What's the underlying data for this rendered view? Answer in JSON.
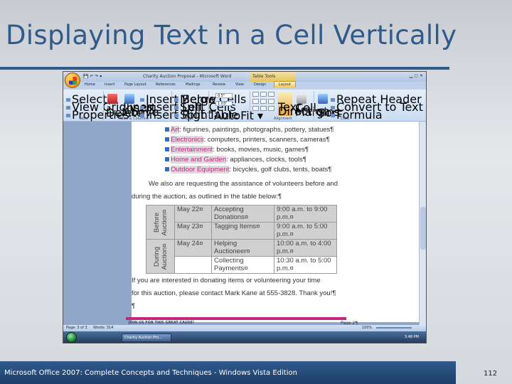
{
  "slide": {
    "title": "Displaying Text in a Cell Vertically",
    "caption": "Microsoft Office 2007: Complete Concepts and Techniques - Windows Vista Edition",
    "page_number": "112"
  },
  "window": {
    "title": "Charity Auction Proposal - Microsoft Word",
    "table_tools_label": "Table Tools",
    "tabs": [
      "Home",
      "Insert",
      "Page Layout",
      "References",
      "Mailings",
      "Review",
      "View",
      "Design",
      "Layout"
    ],
    "active_tab": "Layout"
  },
  "ribbon": {
    "table_group": {
      "select": "Select ▾",
      "view_gridlines": "View Gridlines",
      "properties": "Properties",
      "label": "Table"
    },
    "rows_columns_group": {
      "delete": "Delete",
      "insert_above": "Insert Above",
      "insert_below": "Insert Below",
      "insert_left": "Insert Left",
      "insert_right": "Insert Right",
      "label": "Rows & Columns"
    },
    "merge_group": {
      "merge_cells": "Merge Cells",
      "split_cells": "Split Cells",
      "split_table": "Split Table",
      "label": "Merge"
    },
    "cell_size_group": {
      "height": "0.5\"",
      "width": "1.03\"",
      "autofit": "AutoFit ▾",
      "label": "Cell Size"
    },
    "alignment_group": {
      "text_direction": "Text Direction",
      "cell_margins": "Cell Margins",
      "label": "Alignment"
    },
    "data_group": {
      "sort": "Sort",
      "repeat_header_rows": "Repeat Header Rows",
      "convert_to_text": "Convert to Text",
      "formula": "Formula",
      "label": "Data"
    }
  },
  "document": {
    "bullets": [
      {
        "term": "Art",
        "rest": ": figurines, paintings, photographs, pottery, statues¶"
      },
      {
        "term": "Electronics",
        "rest": ": computers, printers, scanners, cameras¶"
      },
      {
        "term": "Entertainment",
        "rest": ": books, movies, music, games¶"
      },
      {
        "term": "Home and Garden",
        "rest": ": appliances, clocks, tools¶"
      },
      {
        "term": "Outdoor Equipment",
        "rest": ": bicycles, golf clubs, tents, boats¶"
      }
    ],
    "para1_line1": "We also are requesting the assistance of volunteers before and",
    "para1_line2": "during the auction, as outlined in the table below:¶",
    "table": {
      "groups": [
        {
          "label": "Before Auction¤",
          "rows": [
            {
              "date": "May 22¤",
              "task": "Accepting Donations¤",
              "time": "9:00 a.m. to 9:00 p.m.¤"
            },
            {
              "date": "May 23¤",
              "task": "Tagging Items¤",
              "time": "9:00 a.m. to 5:00 p.m.¤"
            }
          ]
        },
        {
          "label": "During Auction¤",
          "rows": [
            {
              "date": "May 24¤",
              "task": "Helping Auctioneer¤",
              "time": "10:00 a.m. to 4:00 p.m.¤"
            },
            {
              "date": "",
              "task": "Collecting Payments¤",
              "time": "10:30 a.m. to 5:00 p.m.¤"
            }
          ]
        }
      ]
    },
    "para2_line1": "If you are interested in donating items or volunteering your time",
    "para2_line2": "for this auction, please contact Mark Kane at 555-3828.  Thank you!¶",
    "empty_para": "¶",
    "footer_text": "JOIN US FOR THIS GREAT CAUSE!",
    "footer_page": "Page 2¶"
  },
  "statusbar": {
    "page": "Page: 3 of 3",
    "words": "Words: 314",
    "zoom": "100%"
  },
  "taskbar": {
    "task_button": "Charity Auction Pro...",
    "clock": "3:48 PM"
  }
}
